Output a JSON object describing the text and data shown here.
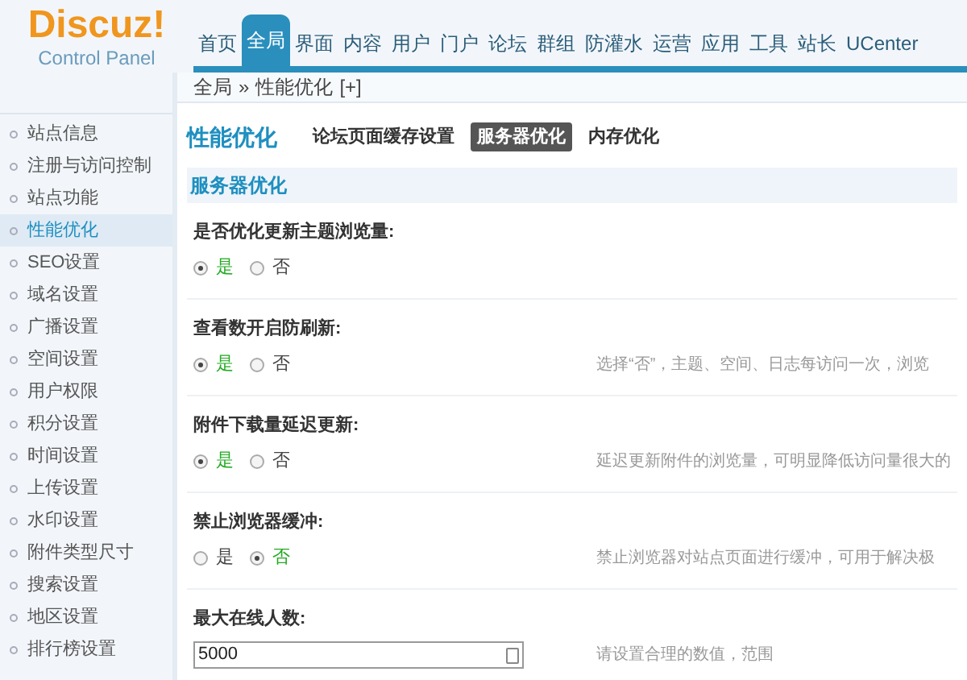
{
  "logo": {
    "name": "Discuz!",
    "subtitle": "Control Panel"
  },
  "top_nav": [
    {
      "label": "首页",
      "selected": false
    },
    {
      "label": "全局",
      "selected": true
    },
    {
      "label": "界面",
      "selected": false
    },
    {
      "label": "内容",
      "selected": false
    },
    {
      "label": "用户",
      "selected": false
    },
    {
      "label": "门户",
      "selected": false
    },
    {
      "label": "论坛",
      "selected": false
    },
    {
      "label": "群组",
      "selected": false
    },
    {
      "label": "防灌水",
      "selected": false
    },
    {
      "label": "运营",
      "selected": false
    },
    {
      "label": "应用",
      "selected": false
    },
    {
      "label": "工具",
      "selected": false
    },
    {
      "label": "站长",
      "selected": false
    },
    {
      "label": "UCenter",
      "selected": false
    }
  ],
  "breadcrumb": {
    "parent": "全局",
    "separator": "»",
    "current": "性能优化",
    "add": "[+]"
  },
  "sidebar": {
    "items": [
      {
        "label": "站点信息",
        "selected": false
      },
      {
        "label": "注册与访问控制",
        "selected": false
      },
      {
        "label": "站点功能",
        "selected": false
      },
      {
        "label": "性能优化",
        "selected": true
      },
      {
        "label": "SEO设置",
        "selected": false
      },
      {
        "label": "域名设置",
        "selected": false
      },
      {
        "label": "广播设置",
        "selected": false
      },
      {
        "label": "空间设置",
        "selected": false
      },
      {
        "label": "用户权限",
        "selected": false
      },
      {
        "label": "积分设置",
        "selected": false
      },
      {
        "label": "时间设置",
        "selected": false
      },
      {
        "label": "上传设置",
        "selected": false
      },
      {
        "label": "水印设置",
        "selected": false
      },
      {
        "label": "附件类型尺寸",
        "selected": false
      },
      {
        "label": "搜索设置",
        "selected": false
      },
      {
        "label": "地区设置",
        "selected": false
      },
      {
        "label": "排行榜设置",
        "selected": false
      }
    ]
  },
  "page_title": "性能优化",
  "sub_tabs": [
    {
      "label": "论坛页面缓存设置",
      "selected": false
    },
    {
      "label": "服务器优化",
      "selected": true
    },
    {
      "label": "内存优化",
      "selected": false
    }
  ],
  "section_title": "服务器优化",
  "settings": [
    {
      "kind": "radio",
      "label": "是否优化更新主题浏览量:",
      "options": [
        {
          "label": "是",
          "selected": true
        },
        {
          "label": "否",
          "selected": false
        }
      ]
    },
    {
      "kind": "radio",
      "label": "查看数开启防刷新:",
      "options": [
        {
          "label": "是",
          "selected": true
        },
        {
          "label": "否",
          "selected": false
        }
      ],
      "hint": "选择“否”，主题、空间、日志每访问一次，浏览"
    },
    {
      "kind": "radio",
      "label": "附件下载量延迟更新:",
      "options": [
        {
          "label": "是",
          "selected": true
        },
        {
          "label": "否",
          "selected": false
        }
      ],
      "hint": "延迟更新附件的浏览量，可明显降低访问量很大的"
    },
    {
      "kind": "radio",
      "label": "禁止浏览器缓冲:",
      "options": [
        {
          "label": "是",
          "selected": false
        },
        {
          "label": "否",
          "selected": true
        }
      ],
      "hint": "禁止浏览器对站点页面进行缓冲，可用于解决极"
    },
    {
      "kind": "number",
      "label": "最大在线人数:",
      "value": "5000",
      "hint": "请设置合理的数值，范围"
    }
  ]
}
